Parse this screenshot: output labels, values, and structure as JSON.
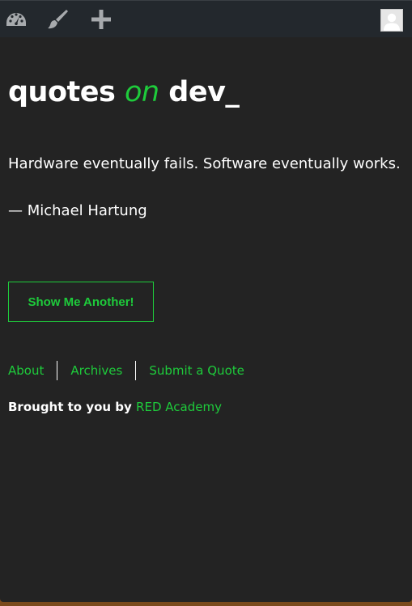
{
  "adminbar": {
    "icons": [
      "dashboard-icon",
      "customize-brush-icon",
      "add-new-icon"
    ],
    "avatar_icon": "user-avatar-icon"
  },
  "site": {
    "title_part1": "quotes ",
    "title_on": "on",
    "title_part2": " dev_"
  },
  "quote": {
    "text": "Hardware eventually fails. Software eventually works.",
    "author": "— Michael Hartung"
  },
  "button": {
    "label": "Show Me Another!"
  },
  "footer": {
    "nav": [
      "About",
      "Archives",
      "Submit a Quote"
    ],
    "credit_prefix": "Brought to you by ",
    "credit_link": "RED Academy"
  },
  "colors": {
    "background": "#232323",
    "adminbar": "#23282d",
    "accent": "#1ecb3b",
    "text": "#ffffff"
  }
}
